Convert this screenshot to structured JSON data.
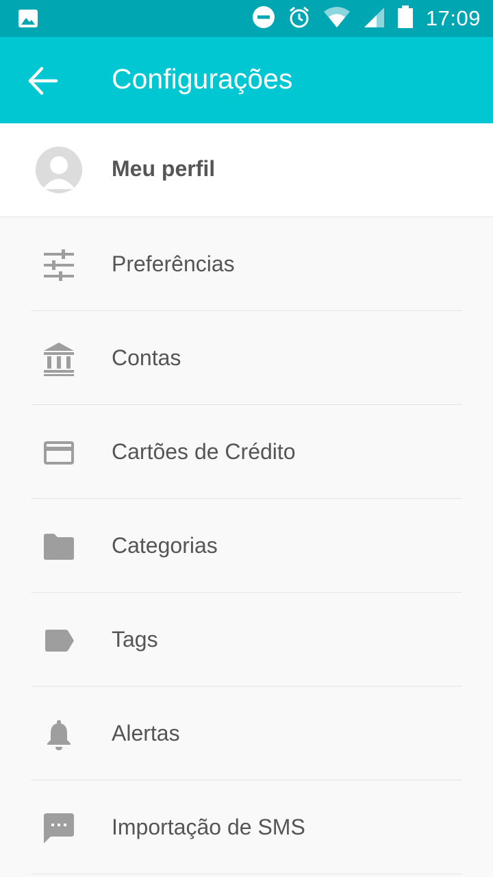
{
  "status_bar": {
    "time": "17:09",
    "icons": [
      "image-icon",
      "do-not-disturb-icon",
      "alarm-icon",
      "wifi-icon",
      "cell-signal-icon",
      "battery-icon"
    ]
  },
  "app_bar": {
    "title": "Configurações",
    "back_icon": "arrow-back-icon",
    "color": "#00c7d2"
  },
  "profile": {
    "label": "Meu perfil",
    "icon": "avatar-icon"
  },
  "menu": {
    "items": [
      {
        "label": "Preferências",
        "icon": "tune-icon"
      },
      {
        "label": "Contas",
        "icon": "bank-icon"
      },
      {
        "label": "Cartões de Crédito",
        "icon": "credit-card-icon"
      },
      {
        "label": "Categorias",
        "icon": "folder-icon"
      },
      {
        "label": "Tags",
        "icon": "tag-icon"
      },
      {
        "label": "Alertas",
        "icon": "bell-icon"
      },
      {
        "label": "Importação de SMS",
        "icon": "sms-icon"
      }
    ]
  },
  "colors": {
    "status_bar": "#00a7b3",
    "app_bar": "#00c7d2",
    "icon_gray": "#9e9e9e",
    "text": "#555555"
  }
}
